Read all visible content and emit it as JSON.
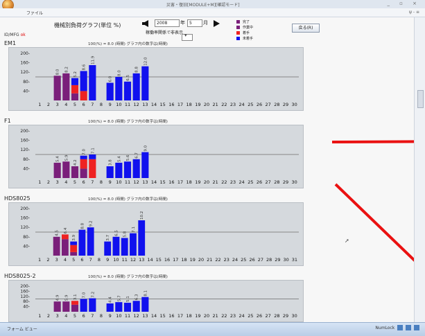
{
  "window": {
    "title": "災害・復旧[MODULE+M][確認モード]",
    "menu": "ファイル",
    "right_glyph": "ψ - ≡"
  },
  "header": {
    "title": "機械別負荷グラフ(単位 %)",
    "year_value": "2008",
    "year_label": "年",
    "month_value": "5",
    "month_label": "月",
    "filter_label": "稼働率関係で非表示",
    "sub_label": "ID/MFG",
    "sub_value": "ok",
    "back_button": "戻る(R)"
  },
  "legend": [
    {
      "label": "完了",
      "color": "#7a1f7a"
    },
    {
      "label": "作業中",
      "color": "#7a1f7a"
    },
    {
      "label": "着手",
      "color": "#ee2222"
    },
    {
      "label": "未着手",
      "color": "#1111ee"
    }
  ],
  "colors": {
    "done": "#7a1f7a",
    "started": "#ee2222",
    "pending": "#1111ee",
    "chart_bg": "#d5d9dd",
    "ref_line": "#6b6b6b"
  },
  "chart_data": [
    {
      "type": "bar",
      "name": "EM1",
      "info": "100(%) = 8.0 (時間)  グラフ内の数字は(時間)",
      "categories": [
        "1",
        "2",
        "3",
        "4",
        "5",
        "6",
        "7",
        "8",
        "9",
        "10",
        "11",
        "12",
        "13",
        "14",
        "15",
        "16",
        "17",
        "18",
        "19",
        "20",
        "21",
        "22",
        "23",
        "24",
        "25",
        "26",
        "27",
        "28",
        "29",
        "30"
      ],
      "ylim": [
        0,
        200
      ],
      "yticks": [
        40,
        80,
        120,
        160,
        200
      ],
      "ref_line": 100,
      "series": [
        {
          "name": "完了",
          "values": [
            0,
            0,
            105,
            115,
            30,
            0,
            0,
            0,
            0,
            0,
            0,
            0,
            0,
            0,
            0,
            0,
            0,
            0,
            0,
            0,
            0,
            0,
            0,
            0,
            0,
            0,
            0,
            0,
            0,
            0
          ]
        },
        {
          "name": "着手",
          "values": [
            0,
            0,
            0,
            0,
            35,
            40,
            0,
            0,
            0,
            0,
            0,
            0,
            0,
            0,
            0,
            0,
            0,
            0,
            0,
            0,
            0,
            0,
            0,
            0,
            0,
            0,
            0,
            0,
            0,
            0
          ]
        },
        {
          "name": "未着手",
          "values": [
            0,
            0,
            0,
            0,
            30,
            85,
            150,
            0,
            75,
            100,
            80,
            115,
            145,
            0,
            0,
            0,
            0,
            0,
            0,
            0,
            0,
            0,
            0,
            0,
            0,
            0,
            0,
            0,
            0,
            0
          ]
        }
      ],
      "labels": {
        "3": "8.0",
        "4": "8.2",
        "5": "5.2",
        "6": "8.6",
        "7": "11.9",
        "9": "6.0",
        "10": "8.0",
        "11": "6.5",
        "12": "8.8",
        "13": "12.0"
      }
    },
    {
      "type": "bar",
      "name": "F1",
      "info": "100(%) = 8.0 (時間)  グラフ内の数字は(時間)",
      "categories": [
        "1",
        "2",
        "3",
        "4",
        "5",
        "6",
        "7",
        "8",
        "9",
        "10",
        "11",
        "12",
        "13",
        "14",
        "15",
        "16",
        "17",
        "18",
        "19",
        "20",
        "21",
        "22",
        "23",
        "24",
        "25",
        "26",
        "27",
        "28",
        "29",
        "30"
      ],
      "ylim": [
        0,
        200
      ],
      "yticks": [
        40,
        80,
        120,
        160,
        200
      ],
      "ref_line": 100,
      "series": [
        {
          "name": "完了",
          "values": [
            0,
            0,
            65,
            70,
            50,
            40,
            0,
            0,
            0,
            0,
            0,
            0,
            0,
            0,
            0,
            0,
            0,
            0,
            0,
            0,
            0,
            0,
            0,
            0,
            0,
            0,
            0,
            0,
            0,
            0
          ]
        },
        {
          "name": "着手",
          "values": [
            0,
            0,
            0,
            0,
            0,
            40,
            80,
            0,
            0,
            0,
            0,
            0,
            0,
            0,
            0,
            0,
            0,
            0,
            0,
            0,
            0,
            0,
            0,
            0,
            0,
            0,
            0,
            0,
            0,
            0
          ]
        },
        {
          "name": "未着手",
          "values": [
            0,
            0,
            0,
            0,
            0,
            15,
            20,
            0,
            50,
            65,
            70,
            80,
            110,
            0,
            0,
            0,
            0,
            0,
            0,
            0,
            0,
            0,
            0,
            0,
            0,
            0,
            0,
            0,
            0,
            0
          ]
        }
      ],
      "labels": {
        "3": "5.4",
        "4": "5.9",
        "5": "4.2",
        "6": "7.0",
        "7": "7.1",
        "9": "3.8",
        "10": "5.4",
        "11": "5.6",
        "12": "6.7",
        "13": "9.0"
      }
    },
    {
      "type": "bar",
      "name": "HDS8025",
      "info": "100(%) = 8.0 (時間)  グラフ内の数字は(時間)",
      "categories": [
        "1",
        "2",
        "3",
        "4",
        "5",
        "6",
        "7",
        "8",
        "9",
        "10",
        "11",
        "12",
        "13",
        "14",
        "15",
        "16",
        "17",
        "18",
        "19",
        "20",
        "21",
        "22",
        "23",
        "24",
        "25",
        "26",
        "27",
        "28",
        "29",
        "30",
        "31"
      ],
      "ylim": [
        0,
        200
      ],
      "yticks": [
        40,
        80,
        120,
        160,
        200
      ],
      "ref_line": 100,
      "series": [
        {
          "name": "完了",
          "values": [
            0,
            0,
            80,
            70,
            15,
            0,
            0,
            0,
            0,
            0,
            0,
            0,
            0,
            0,
            0,
            0,
            0,
            0,
            0,
            0,
            0,
            0,
            0,
            0,
            0,
            0,
            0,
            0,
            0,
            0,
            0
          ]
        },
        {
          "name": "着手",
          "values": [
            0,
            0,
            0,
            20,
            30,
            0,
            0,
            0,
            0,
            0,
            0,
            0,
            0,
            0,
            0,
            0,
            0,
            0,
            0,
            0,
            0,
            0,
            0,
            0,
            0,
            0,
            0,
            0,
            0,
            0,
            0
          ]
        },
        {
          "name": "未着手",
          "values": [
            0,
            0,
            0,
            0,
            15,
            110,
            120,
            0,
            60,
            80,
            75,
            95,
            150,
            0,
            0,
            0,
            0,
            0,
            0,
            0,
            0,
            0,
            0,
            0,
            0,
            0,
            0,
            0,
            0,
            0,
            0
          ]
        }
      ],
      "labels": {
        "3": "4.5",
        "4": "6.4",
        "5": "3.9",
        "6": "8.8",
        "7": "9.2",
        "9": "3.7",
        "10": "6.5",
        "11": "5.8",
        "12": "7.1",
        "13": "10.2"
      }
    },
    {
      "type": "bar",
      "name": "HDS8025-2",
      "info": "100(%) = 8.0 (時間)  グラフ内の数字は(時間)",
      "categories": [
        "1",
        "2",
        "3",
        "4",
        "5",
        "6",
        "7",
        "8",
        "9",
        "10",
        "11",
        "12",
        "13",
        "14",
        "15",
        "16",
        "17",
        "18",
        "19",
        "20",
        "21",
        "22",
        "23",
        "24",
        "25",
        "26",
        "27",
        "28",
        "29",
        "30"
      ],
      "ylim": [
        0,
        200
      ],
      "yticks": [
        40,
        80,
        120,
        160,
        200
      ],
      "ref_line": 100,
      "series": [
        {
          "name": "完了",
          "values": [
            0,
            0,
            80,
            80,
            55,
            0,
            0,
            0,
            0,
            0,
            0,
            0,
            0,
            0,
            0,
            0,
            0,
            0,
            0,
            0,
            0,
            0,
            0,
            0,
            0,
            0,
            0,
            0,
            0,
            0
          ]
        },
        {
          "name": "着手",
          "values": [
            0,
            0,
            0,
            0,
            30,
            0,
            0,
            0,
            0,
            0,
            0,
            0,
            0,
            0,
            0,
            0,
            0,
            0,
            0,
            0,
            0,
            0,
            0,
            0,
            0,
            0,
            0,
            0,
            0,
            0
          ]
        },
        {
          "name": "未着手",
          "values": [
            0,
            0,
            0,
            0,
            0,
            100,
            105,
            0,
            65,
            75,
            70,
            85,
            115,
            0,
            0,
            0,
            0,
            0,
            0,
            0,
            0,
            0,
            0,
            0,
            0,
            0,
            0,
            0,
            0,
            0
          ]
        }
      ],
      "labels": {
        "3": "4.9",
        "4": "5.9",
        "5": "3.1",
        "6": "7.0",
        "7": "7.2",
        "9": "4.4",
        "10": "5.7",
        "11": "5.1",
        "12": "6.3",
        "13": "8.1"
      }
    }
  ],
  "taskbar": {
    "form": "フォーム ビュー",
    "tray": "NumLock"
  }
}
